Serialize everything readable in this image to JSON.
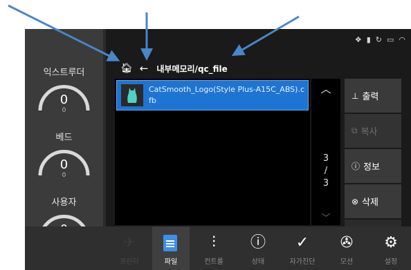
{
  "status_icons": [
    "settings-cluster-icon",
    "sd-card-icon",
    "refresh-icon",
    "camera-icon",
    "wifi-icon"
  ],
  "path_bar": {
    "path": "내부메모리/qc_file"
  },
  "gauges": [
    {
      "label": "익스트루더",
      "value": "0",
      "sub": "0"
    },
    {
      "label": "베드",
      "value": "0",
      "sub": "0"
    },
    {
      "label": "사용자",
      "value": "0",
      "sub": "0g"
    }
  ],
  "file_list": [
    {
      "name": "CatSmooth_Logo(Style Plus-A15C_ABS).cfb",
      "selected": true
    }
  ],
  "pagination": {
    "current": "3",
    "separator": "/",
    "total": "3"
  },
  "actions": [
    {
      "label": "출력",
      "icon": "print-icon",
      "enabled": true
    },
    {
      "label": "복사",
      "icon": "copy-icon",
      "enabled": false
    },
    {
      "label": "정보",
      "icon": "info-icon",
      "enabled": true
    },
    {
      "label": "삭제",
      "icon": "delete-icon",
      "enabled": true
    }
  ],
  "nav": [
    {
      "label": "프린터",
      "icon": "printer-icon",
      "active": false
    },
    {
      "label": "파일",
      "icon": "file-icon",
      "active": true
    },
    {
      "label": "컨트롤",
      "icon": "sliders-icon",
      "active": false
    },
    {
      "label": "상태",
      "icon": "info-icon",
      "active": false
    },
    {
      "label": "자가진단",
      "icon": "check-icon",
      "active": false
    },
    {
      "label": "모션",
      "icon": "fan-icon",
      "active": false
    },
    {
      "label": "설정",
      "icon": "gear-icon",
      "active": false
    }
  ],
  "colors": {
    "accent": "#1e74d3",
    "background": "#1a1a1a",
    "panel": "#3b3b3b",
    "annotation": "#4a86c8"
  }
}
